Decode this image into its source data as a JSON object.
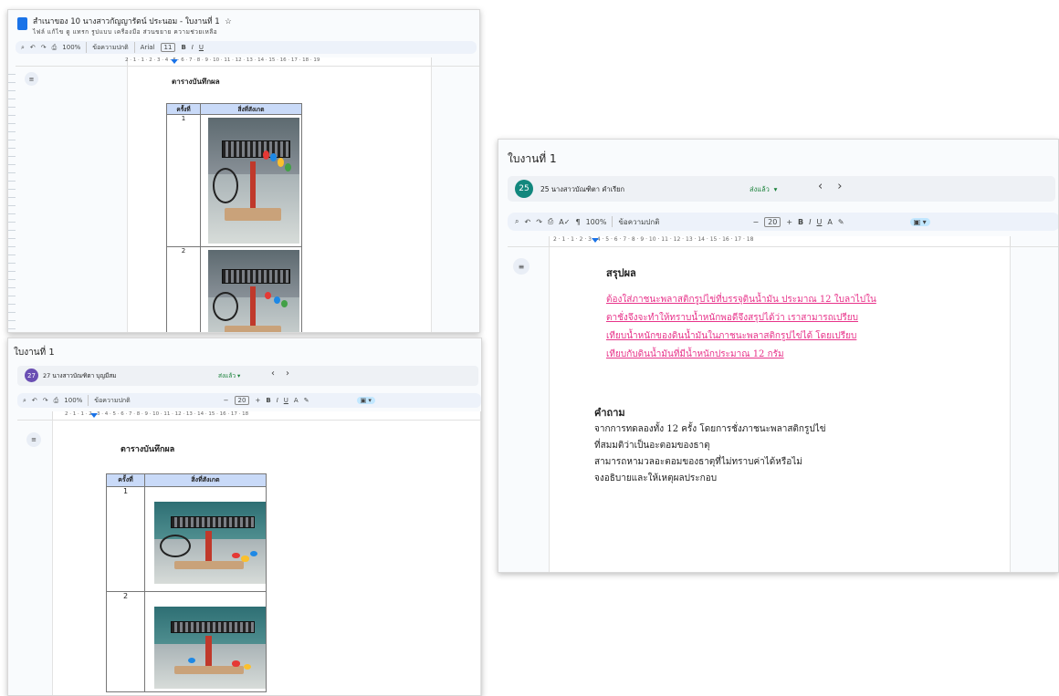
{
  "shot_a": {
    "doc_title": "สำเนาของ 10 นางสาวกัญญารัตน์ ประนอม - ใบงานที่ 1",
    "menu": "ไฟล์ แก้ไข ดู แทรก รูปแบบ เครื่องมือ ส่วนขยาย ความช่วยเหลือ",
    "toolbar": {
      "zoom": "100%",
      "style": "ข้อความปกติ",
      "font": "Arial",
      "size": "11"
    },
    "ruler": "2 · 1 · 1 · 2 · 3 · 4 · 5 · 6 · 7 · 8 · 9 · 10 · 11 · 12 · 13 · 14 · 15 · 16 · 17 · 18 · 19",
    "heading": "ตารางบันทึกผล",
    "table_headers": [
      "ครั้งที่",
      "สิ่งที่สังเกต"
    ],
    "rows": [
      "1",
      "2"
    ]
  },
  "shot_b": {
    "window_title": "ใบงานที่ 1",
    "avatar_number": "27",
    "student_name": "27 นางสาวบัณฑิตา บุญมีสม",
    "status": "ส่งแล้ว",
    "toolbar": {
      "zoom": "100%",
      "style": "ข้อความปกติ",
      "size": "20"
    },
    "ruler": "2 · 1 · 1 · 2 · 3 · 4 · 5 · 6 · 7 · 8 · 9 · 10 · 11 · 12 · 13 · 14 · 15 · 16 · 17 · 18",
    "heading": "ตารางบันทึกผล",
    "table_headers": [
      "ครั้งที่",
      "สิ่งที่สังเกต"
    ],
    "rows": [
      "1",
      "2"
    ]
  },
  "shot_c": {
    "window_title": "ใบงานที่ 1",
    "avatar_number": "25",
    "student_name": "25 นางสาวบัณฑิตา คำเรียก",
    "status": "ส่งแล้ว",
    "toolbar": {
      "zoom": "100%",
      "style": "ข้อความปกติ",
      "size": "20"
    },
    "ruler": "2 · 1 · 1 · 2 · 3 · 4 · 5 · 6 · 7 · 8 · 9 · 10 · 11 · 12 · 13 · 14 · 15 · 16 · 17 · 18",
    "summary_heading": "สรุปผล",
    "summary_lines": [
      "ต้องใส่ภาชนะพลาสติกรูปไข่ที่บรรจุดินน้ำมัน ประมาณ 12 ใบลาไปใน",
      "ตาชั่งจึงจะทำให้ทราบน้ำหนักพอดีจึงสรุปได้ว่า เราสามารถเปรียบ",
      "เทียบน้ำหนักของดินน้ำมันในภาชนะพลาสติกรูปไข่ได้ โดยเปรียบ",
      "เทียบกับดินน้ำมันที่มีน้ำหนักประมาณ 12 กรัม"
    ],
    "question_heading": "คำถาม",
    "question_lines": [
      "จากการทดลองทั้ง   12   ครั้ง   โดยการชั่งภาชนะพลาสติกรูปไข่",
      "ที่สมมติว่าเป็นอะตอมของธาตุ",
      "สามารถหามวลอะตอมของธาตุที่ไม่ทราบค่าได้หรือไม่",
      "จงอธิบายและให้เหตุผลประกอบ"
    ]
  },
  "colors": {
    "accent": "#1a73e8",
    "summary_text": "#e8338a",
    "header_cell": "#c9daf8"
  }
}
